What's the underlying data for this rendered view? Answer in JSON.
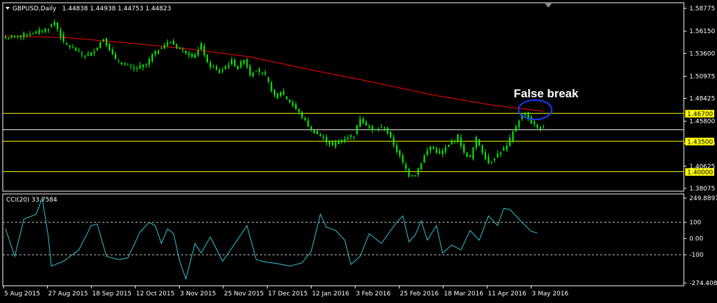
{
  "header": {
    "symbol": "GBPUSD,Daily",
    "ohlc": "1.44838 1.44938 1.44753 1.44823"
  },
  "indicator": {
    "label": "CCI(20) 33.7584"
  },
  "annotation": {
    "text": "False break"
  },
  "colors": {
    "background": "#000000",
    "candle": "#00ff00",
    "moving_average": "#ff0000",
    "level_lines": "#ffff00",
    "cci_line": "#33c5d6",
    "highlight_ellipse": "#1a3cff",
    "grid": "#ffffff"
  },
  "chart_data": [
    {
      "type": "candlestick",
      "title": "GBPUSD,Daily",
      "price_ticks": [
        "1.58775",
        "1.56150",
        "1.53600",
        "1.50975",
        "1.48425",
        "1.45800",
        "1.43250",
        "1.40625",
        "1.38075"
      ],
      "ylim": [
        1.3807,
        1.5878
      ],
      "horizontal_levels": [
        {
          "value": 1.467,
          "label": "1.46700",
          "color": "#ffff00"
        },
        {
          "value": 1.4482,
          "label": "1.44823",
          "color": "#ffffff"
        },
        {
          "value": 1.435,
          "label": "1.43500",
          "color": "#ffff00"
        },
        {
          "value": 1.4,
          "label": "1.40000",
          "color": "#ffff00"
        }
      ],
      "date_ticks": [
        "5 Aug 2015",
        "27 Aug 2015",
        "18 Sep 2015",
        "12 Oct 2015",
        "3 Nov 2015",
        "25 Nov 2015",
        "17 Dec 2015",
        "12 Jan 2016",
        "3 Feb 2016",
        "25 Feb 2016",
        "18 Mar 2016",
        "11 Apr 2016",
        "3 May 2016"
      ],
      "close_path": [
        [
          0,
          1.553
        ],
        [
          4,
          1.556
        ],
        [
          10,
          1.56
        ],
        [
          14,
          1.565
        ],
        [
          16,
          1.572
        ],
        [
          19,
          1.548
        ],
        [
          26,
          1.533
        ],
        [
          28,
          1.536
        ],
        [
          30,
          1.544
        ],
        [
          32,
          1.553
        ],
        [
          36,
          1.528
        ],
        [
          42,
          1.518
        ],
        [
          46,
          1.523
        ],
        [
          48,
          1.534
        ],
        [
          52,
          1.546
        ],
        [
          54,
          1.549
        ],
        [
          57,
          1.541
        ],
        [
          62,
          1.532
        ],
        [
          64,
          1.546
        ],
        [
          66,
          1.524
        ],
        [
          70,
          1.514
        ],
        [
          72,
          1.521
        ],
        [
          74,
          1.527
        ],
        [
          76,
          1.519
        ],
        [
          78,
          1.53
        ],
        [
          80,
          1.512
        ],
        [
          82,
          1.518
        ],
        [
          85,
          1.51
        ],
        [
          88,
          1.486
        ],
        [
          90,
          1.492
        ],
        [
          93,
          1.48
        ],
        [
          96,
          1.468
        ],
        [
          100,
          1.448
        ],
        [
          104,
          1.438
        ],
        [
          107,
          1.43
        ],
        [
          110,
          1.437
        ],
        [
          114,
          1.442
        ],
        [
          116,
          1.462
        ],
        [
          120,
          1.447
        ],
        [
          124,
          1.451
        ],
        [
          127,
          1.431
        ],
        [
          130,
          1.41
        ],
        [
          132,
          1.396
        ],
        [
          134,
          1.397
        ],
        [
          137,
          1.418
        ],
        [
          139,
          1.429
        ],
        [
          142,
          1.42
        ],
        [
          145,
          1.43
        ],
        [
          148,
          1.441
        ],
        [
          150,
          1.421
        ],
        [
          152,
          1.416
        ],
        [
          154,
          1.438
        ],
        [
          156,
          1.423
        ],
        [
          158,
          1.41
        ],
        [
          161,
          1.42
        ],
        [
          164,
          1.429
        ],
        [
          166,
          1.445
        ],
        [
          168,
          1.46
        ],
        [
          170,
          1.468
        ],
        [
          172,
          1.456
        ],
        [
          174,
          1.451
        ],
        [
          176,
          1.4482
        ]
      ],
      "moving_average_path": [
        [
          0,
          1.556
        ],
        [
          20,
          1.554
        ],
        [
          40,
          1.548
        ],
        [
          60,
          1.541
        ],
        [
          80,
          1.532
        ],
        [
          100,
          1.517
        ],
        [
          120,
          1.503
        ],
        [
          140,
          1.488
        ],
        [
          160,
          1.476
        ],
        [
          176,
          1.4695
        ]
      ],
      "annotation": {
        "text": "False break",
        "at": [
          172,
          1.469
        ]
      },
      "bar_count": 177
    },
    {
      "type": "line",
      "title": "CCI(20) 33.7584",
      "y_ticks": [
        "249.8897",
        "100",
        "0.00",
        "-100",
        "-274.4081"
      ],
      "ylim": [
        -274.4081,
        249.8897
      ],
      "reference_lines": [
        100,
        -100
      ],
      "path": [
        [
          0,
          60
        ],
        [
          3,
          -110
        ],
        [
          6,
          120
        ],
        [
          10,
          150
        ],
        [
          12,
          250
        ],
        [
          14,
          10
        ],
        [
          15,
          -170
        ],
        [
          19,
          -140
        ],
        [
          24,
          -70
        ],
        [
          28,
          80
        ],
        [
          30,
          90
        ],
        [
          33,
          -110
        ],
        [
          37,
          -130
        ],
        [
          40,
          -120
        ],
        [
          44,
          40
        ],
        [
          47,
          100
        ],
        [
          49,
          80
        ],
        [
          51,
          -30
        ],
        [
          53,
          60
        ],
        [
          55,
          30
        ],
        [
          57,
          -140
        ],
        [
          59,
          -250
        ],
        [
          62,
          -30
        ],
        [
          64,
          -90
        ],
        [
          67,
          10
        ],
        [
          71,
          -140
        ],
        [
          74,
          -60
        ],
        [
          79,
          80
        ],
        [
          82,
          -130
        ],
        [
          85,
          -145
        ],
        [
          89,
          -155
        ],
        [
          93,
          -170
        ],
        [
          97,
          -150
        ],
        [
          100,
          -80
        ],
        [
          103,
          150
        ],
        [
          105,
          70
        ],
        [
          108,
          50
        ],
        [
          111,
          -10
        ],
        [
          113,
          -160
        ],
        [
          116,
          -110
        ],
        [
          119,
          30
        ],
        [
          123,
          -30
        ],
        [
          126,
          50
        ],
        [
          128,
          100
        ],
        [
          130,
          140
        ],
        [
          132,
          -20
        ],
        [
          134,
          20
        ],
        [
          136,
          110
        ],
        [
          138,
          -10
        ],
        [
          141,
          80
        ],
        [
          143,
          -90
        ],
        [
          146,
          -40
        ],
        [
          149,
          -70
        ],
        [
          152,
          50
        ],
        [
          155,
          -10
        ],
        [
          158,
          140
        ],
        [
          161,
          80
        ],
        [
          163,
          185
        ],
        [
          165,
          180
        ],
        [
          167,
          140
        ],
        [
          169,
          100
        ],
        [
          172,
          45
        ],
        [
          174,
          33.7584
        ]
      ],
      "bar_count": 177
    }
  ]
}
